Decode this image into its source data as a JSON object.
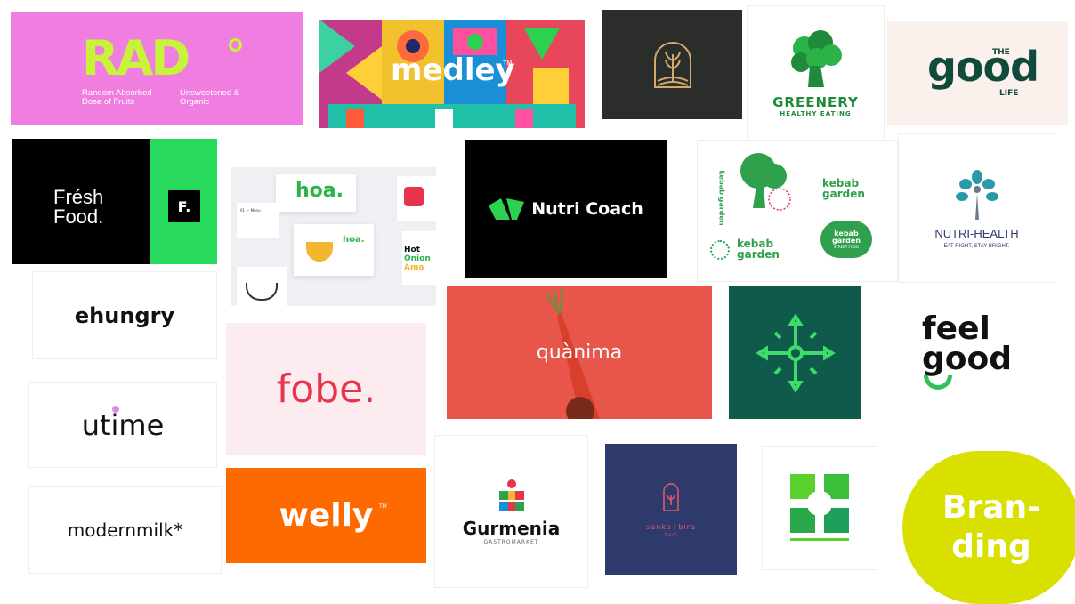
{
  "rad": {
    "logo": "RAD",
    "left_text": "Random Absorbed Dose of Fruits",
    "right_text": "Unsweetened & Organic",
    "bg": "#f07ee0",
    "accent": "#c9f23a"
  },
  "medley": {
    "logo": "medley",
    "tm": "TM"
  },
  "greenery": {
    "name": "GREENERY",
    "tagline": "HEALTHY EATING",
    "color": "#1f8a3a"
  },
  "good_life": {
    "the": "THE",
    "good": "good",
    "life": "LIFE",
    "color": "#0f4a3a"
  },
  "fresh_food": {
    "line1": "Frésh",
    "line2": "Food.",
    "badge": "F.",
    "accent": "#27d95c"
  },
  "hoa": {
    "logo": "hoa.",
    "item_hot": "Hot",
    "item_onion": "Onion",
    "item_ama": "Ama",
    "menu_label": "01 — Menu"
  },
  "nutri_coach": {
    "name": "Nutri Coach",
    "accent": "#2bd14f"
  },
  "kebab_garden": {
    "name1": "kebab garden",
    "name2": "kebab garden",
    "name3": "kebab garden",
    "badge_top": "kebab garden",
    "badge_bottom": "STREET FOOD",
    "vertical": "kebab garden",
    "color": "#2fa04b"
  },
  "nutri_health": {
    "name": "NUTRI-HEALTH",
    "tagline": "EAT RIGHT, STAY BRIGHT."
  },
  "ehungry": {
    "logo": "ehungry"
  },
  "fobe": {
    "logo": "fobe.",
    "color": "#e8334a"
  },
  "quanima": {
    "logo": "quànima",
    "bg": "#e8554a"
  },
  "feel_good": {
    "line1": "feel",
    "line2": "good",
    "accent": "#2fc15a"
  },
  "utime": {
    "logo": "utime",
    "dot_color": "#d98cf0"
  },
  "modernmilk": {
    "logo": "modernmilk*"
  },
  "welly": {
    "logo": "welly",
    "tm": "TM",
    "bg": "#ff6a00"
  },
  "gurmenia": {
    "name": "Gurmenia",
    "tagline": "GASTROMARKET"
  },
  "sanka_bira": {
    "name": "sanka+bira",
    "tagline": "TEA CO",
    "bg": "#2e3a6b",
    "accent": "#e85a6a"
  },
  "branding": {
    "line1": "Bran-",
    "line2": "ding",
    "bg": "#d9e000"
  }
}
